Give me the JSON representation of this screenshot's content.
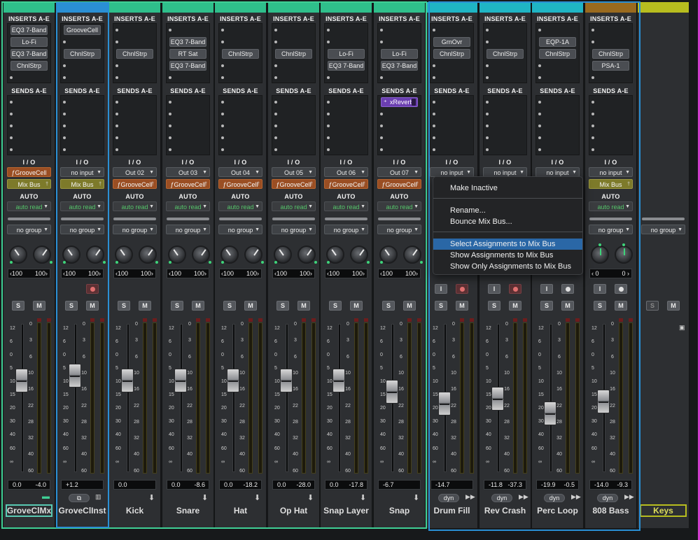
{
  "labels": {
    "inserts": "INSERTS A-E",
    "sends": "SENDS A-E",
    "io": "I / O",
    "auto": "AUTO"
  },
  "scale_fader": [
    "12",
    "6",
    "0",
    "5",
    "10",
    "15",
    "20",
    "30",
    "40",
    "60",
    "∞"
  ],
  "scale_meter": [
    "0",
    "3",
    "6",
    "10",
    "16",
    "22",
    "28",
    "32",
    "40",
    "60"
  ],
  "strips": [
    {
      "name": "GroveClMx",
      "color": "#2fbf8b",
      "inserts": [
        "EQ3 7-Band",
        "Lo-Fi",
        "EQ3 7-Band",
        "ChnlStrp",
        ""
      ],
      "sends": [],
      "input": "ƒGrooveCell",
      "input_style": "orange",
      "output": "Mix Bus",
      "output_style": "olive",
      "auto": "auto read",
      "group": "no group",
      "pan_l": "‹100",
      "pan_r": "100›",
      "vol_l": "0.0",
      "vol_r": "-4.0",
      "fader": 0.27,
      "rec": false,
      "footer": "folder",
      "knob": "normal"
    },
    {
      "name": "GroveClInst",
      "color": "#2a8fd4",
      "inserts": [
        "GrooveCell",
        "",
        "ChnlStrp",
        "",
        ""
      ],
      "sends": [],
      "input": "no input",
      "input_style": "dark",
      "output": "Mix Bus",
      "output_style": "olive",
      "auto": "auto read",
      "group": "no group",
      "pan_l": "‹100",
      "pan_r": "100›",
      "vol_l": "+1.2",
      "vol_r": "",
      "fader": 0.22,
      "rec": true,
      "footer": "inst",
      "knob": "normal"
    },
    {
      "name": "Kick",
      "color": "#2fbf8b",
      "inserts": [
        "",
        "",
        "ChnlStrp",
        "",
        ""
      ],
      "sends": [],
      "input": "Out 02",
      "input_style": "dark",
      "output": "ƒGrooveCell",
      "output_style": "orange",
      "auto": "auto read",
      "group": "no group",
      "pan_l": "‹100",
      "pan_r": "100›",
      "vol_l": "0.0",
      "vol_r": "",
      "fader": 0.27,
      "rec": false,
      "footer": "down",
      "knob": "normal"
    },
    {
      "name": "Snare",
      "color": "#2fbf8b",
      "inserts": [
        "",
        "EQ3 7-Band",
        "RT Sat",
        "EQ3 7-Band",
        ""
      ],
      "sends": [],
      "input": "Out 03",
      "input_style": "dark",
      "output": "ƒGrooveCell",
      "output_style": "orange",
      "auto": "auto read",
      "group": "no group",
      "pan_l": "‹100",
      "pan_r": "100›",
      "vol_l": "0.0",
      "vol_r": "-8.6",
      "fader": 0.27,
      "rec": false,
      "footer": "down",
      "knob": "normal"
    },
    {
      "name": "Hat",
      "color": "#2fbf8b",
      "inserts": [
        "",
        "",
        "ChnlStrp",
        "",
        ""
      ],
      "sends": [],
      "input": "Out 04",
      "input_style": "dark",
      "output": "ƒGrooveCell",
      "output_style": "orange",
      "auto": "auto read",
      "group": "no group",
      "pan_l": "‹100",
      "pan_r": "100›",
      "vol_l": "0.0",
      "vol_r": "-18.2",
      "fader": 0.27,
      "rec": false,
      "footer": "down",
      "knob": "normal"
    },
    {
      "name": "Op Hat",
      "color": "#2fbf8b",
      "inserts": [
        "",
        "",
        "ChnlStrp",
        "",
        ""
      ],
      "sends": [],
      "input": "Out 05",
      "input_style": "dark",
      "output": "ƒGrooveCell",
      "output_style": "orange",
      "auto": "auto read",
      "group": "no group",
      "pan_l": "‹100",
      "pan_r": "100›",
      "vol_l": "0.0",
      "vol_r": "-28.0",
      "fader": 0.27,
      "rec": false,
      "footer": "down",
      "knob": "normal"
    },
    {
      "name": "Snap Layer",
      "color": "#2fbf8b",
      "inserts": [
        "",
        "",
        "Lo-Fi",
        "EQ3 7-Band",
        ""
      ],
      "sends": [],
      "input": "Out 06",
      "input_style": "dark",
      "output": "ƒGrooveCell",
      "output_style": "orange",
      "auto": "auto read",
      "group": "no group",
      "pan_l": "‹100",
      "pan_r": "100›",
      "vol_l": "0.0",
      "vol_r": "-17.8",
      "fader": 0.27,
      "rec": false,
      "footer": "down",
      "knob": "normal"
    },
    {
      "name": "Snap",
      "color": "#2fbf8b",
      "inserts": [
        "",
        "",
        "Lo-Fi",
        "EQ3 7-Band",
        ""
      ],
      "sends": [
        "xReverb",
        "",
        "",
        "",
        ""
      ],
      "input": "Out 07",
      "input_style": "dark",
      "output": "ƒGrooveCell",
      "output_style": "orange",
      "auto": "auto read",
      "group": "no group",
      "pan_l": "‹100",
      "pan_r": "100›",
      "vol_l": "-6.7",
      "vol_r": "",
      "fader": 0.38,
      "rec": false,
      "footer": "down",
      "knob": "normal"
    },
    {
      "name": "Drum Fill",
      "color": "#1fb5c4",
      "inserts": [
        "",
        "GrnOvr",
        "ChnlStrp",
        "",
        ""
      ],
      "sends": [],
      "input": "no input",
      "input_style": "dark",
      "output": "",
      "output_style": "none",
      "auto": "",
      "group": "",
      "pan_l": "",
      "pan_r": "",
      "vol_l": "-14.7",
      "vol_r": "",
      "fader": 0.5,
      "rec": true,
      "footer": "dyn",
      "knob": "none",
      "has_i": true
    },
    {
      "name": "Rev Crash",
      "color": "#1fb5c4",
      "inserts": [
        "",
        "",
        "ChnlStrp",
        "",
        ""
      ],
      "sends": [],
      "input": "no input",
      "input_style": "dark",
      "output": "",
      "output_style": "none",
      "auto": "",
      "group": "",
      "pan_l": "",
      "pan_r": "",
      "vol_l": "-11.8",
      "vol_r": "-37.3",
      "fader": 0.45,
      "rec": true,
      "footer": "dyn",
      "knob": "none",
      "has_i": true
    },
    {
      "name": "Perc Loop",
      "color": "#1fb5c4",
      "inserts": [
        "",
        "EQP-1A",
        "ChnlStrp",
        "",
        ""
      ],
      "sends": [],
      "input": "no input",
      "input_style": "dark",
      "output": "",
      "output_style": "none",
      "auto": "",
      "group": "",
      "pan_l": "",
      "pan_r": "",
      "vol_l": "-19.9",
      "vol_r": "-0.5",
      "fader": 0.6,
      "rec": false,
      "footer": "dyn",
      "knob": "none",
      "has_i": true
    },
    {
      "name": "808 Bass",
      "color": "#9a6a1e",
      "inserts": [
        "",
        "",
        "ChnlStrp",
        "PSA-1",
        ""
      ],
      "sends": [],
      "input": "no input",
      "input_style": "dark",
      "output": "Mix Bus",
      "output_style": "olive",
      "auto": "auto read",
      "group": "no group",
      "pan_l": "‹ 0",
      "pan_r": "0 ›",
      "vol_l": "-14.0",
      "vol_r": "-9.3",
      "fader": 0.48,
      "rec": false,
      "footer": "dyn",
      "knob": "green",
      "has_i": true
    },
    {
      "name": "Keys",
      "color": "#b7bd1f",
      "inserts": [],
      "sends": [],
      "input": "",
      "input_style": "none",
      "output": "",
      "output_style": "none",
      "auto": "",
      "group": "no group",
      "pan_l": "",
      "pan_r": "",
      "vol_l": "",
      "vol_r": "",
      "fader": null,
      "rec": false,
      "footer": "none",
      "knob": "none",
      "folder": true
    }
  ],
  "context_menu": {
    "items": [
      "Make Inactive",
      "Rename...",
      "Bounce Mix Bus...",
      "Select Assignments to Mix Bus",
      "Show Assignments to Mix Bus",
      "Show Only Assignments to Mix Bus"
    ],
    "highlighted": 3
  },
  "footer": {
    "dyn": "dyn"
  },
  "colors": {
    "green_outline": "#3fcf95",
    "blue_outline": "#2a8fd4",
    "highlight": "#2a67a6",
    "magenta_edge": "#d43fd0"
  }
}
